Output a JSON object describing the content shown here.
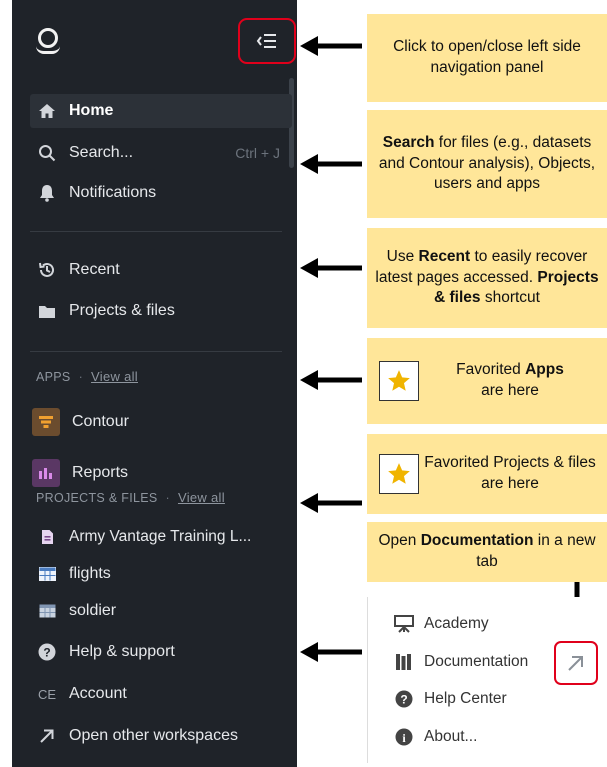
{
  "sidebar": {
    "toggle_icon": "collapse-sidebar-icon",
    "primary": [
      {
        "label": "Home",
        "icon": "home-icon"
      },
      {
        "label": "Search...",
        "icon": "search-icon",
        "shortcut": "Ctrl + J"
      },
      {
        "label": "Notifications",
        "icon": "bell-icon"
      }
    ],
    "secondary": [
      {
        "label": "Recent",
        "icon": "history-icon"
      },
      {
        "label": "Projects & files",
        "icon": "folder-icon"
      }
    ],
    "apps_section": {
      "label": "APPS",
      "view_all": "View all"
    },
    "apps": [
      {
        "label": "Contour",
        "icon": "contour-app-icon",
        "color": "#6b4c2e"
      },
      {
        "label": "Reports",
        "icon": "reports-app-icon",
        "color": "#5a3764"
      }
    ],
    "projects_section": {
      "label": "PROJECTS & FILES",
      "view_all": "View all"
    },
    "projects": [
      {
        "label": "Army Vantage Training L...",
        "icon": "document-icon"
      },
      {
        "label": "flights",
        "icon": "dataset-icon"
      },
      {
        "label": "soldier",
        "icon": "dataset-icon"
      }
    ],
    "footer": [
      {
        "label": "Help & support",
        "icon": "help-icon"
      },
      {
        "label": "Account",
        "icon": "account-icon",
        "initials": "CE"
      },
      {
        "label": "Open other workspaces",
        "icon": "external-arrow-icon"
      }
    ]
  },
  "callouts": {
    "toggle": {
      "text": "Click to open/close left side navigation panel"
    },
    "search": {
      "bold": "Search",
      "text": " for files (e.g., datasets and Contour analysis), Objects, users and apps"
    },
    "recent": {
      "text1": "Use ",
      "bold1": "Recent",
      "text2": " to easily recover latest pages accessed. ",
      "bold2": "Projects & files",
      "text3": " shortcut"
    },
    "apps": {
      "text1": "Favorited ",
      "bold1": "Apps",
      "text2": " are here"
    },
    "projects": {
      "text": "Favorited Projects & files are here"
    },
    "docs": {
      "text1": "Open ",
      "bold1": "Documentation",
      "text2": " in a new tab"
    }
  },
  "help_menu": [
    {
      "label": "Academy",
      "icon": "academy-icon"
    },
    {
      "label": "Documentation",
      "icon": "documentation-icon"
    },
    {
      "label": "Help Center",
      "icon": "help-icon"
    },
    {
      "label": "About...",
      "icon": "info-icon"
    }
  ],
  "colors": {
    "sidebar_bg": "#1f2329",
    "callout_bg": "#ffe699",
    "highlight": "#e0001b",
    "star": "#f0b400"
  }
}
